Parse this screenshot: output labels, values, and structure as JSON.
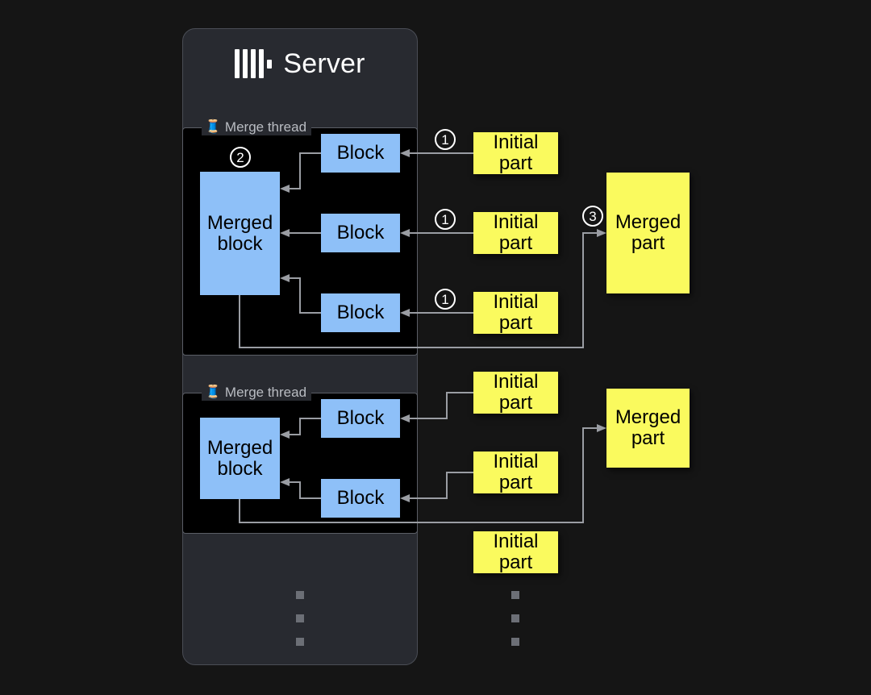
{
  "page": {
    "background": "#151515",
    "title": "ClickHouse merge thread diagram"
  },
  "server": {
    "title": "Server",
    "logo_icon": "clickhouse-logo",
    "card_color": "#282a30",
    "border_color": "#4a4d55"
  },
  "threads": [
    {
      "id": "thread-1",
      "label": "Merge thread",
      "icon": "thread-spool-icon",
      "merged_block": {
        "label": "Merged\nblock",
        "line1": "Merged",
        "line2": "block",
        "color": "#8ec0f8"
      },
      "blocks": [
        {
          "label": "Block",
          "color": "#8ec0f8"
        },
        {
          "label": "Block",
          "color": "#8ec0f8"
        },
        {
          "label": "Block",
          "color": "#8ec0f8"
        }
      ]
    },
    {
      "id": "thread-2",
      "label": "Merge thread",
      "icon": "thread-spool-icon",
      "merged_block": {
        "label": "Merged\nblock",
        "line1": "Merged",
        "line2": "block",
        "color": "#8ec0f8"
      },
      "blocks": [
        {
          "label": "Block",
          "color": "#8ec0f8"
        },
        {
          "label": "Block",
          "color": "#8ec0f8"
        }
      ]
    }
  ],
  "initial_parts": [
    {
      "line1": "Initial",
      "line2": "part",
      "color": "#fafa5e"
    },
    {
      "line1": "Initial",
      "line2": "part",
      "color": "#fafa5e"
    },
    {
      "line1": "Initial",
      "line2": "part",
      "color": "#fafa5e"
    },
    {
      "line1": "Initial",
      "line2": "part",
      "color": "#fafa5e"
    },
    {
      "line1": "Initial",
      "line2": "part",
      "color": "#fafa5e"
    },
    {
      "line1": "Initial",
      "line2": "part",
      "color": "#fafa5e"
    }
  ],
  "merged_parts": [
    {
      "line1": "Merged",
      "line2": "part",
      "color": "#fafa5e"
    },
    {
      "line1": "Merged",
      "line2": "part",
      "color": "#fafa5e"
    }
  ],
  "steps": [
    {
      "id": "step-1a",
      "label": "①",
      "number": "1"
    },
    {
      "id": "step-1b",
      "label": "①",
      "number": "1"
    },
    {
      "id": "step-1c",
      "label": "①",
      "number": "1"
    },
    {
      "id": "step-2",
      "label": "②",
      "number": "2"
    },
    {
      "id": "step-3",
      "label": "③",
      "number": "3"
    }
  ],
  "ellipsis": {
    "glyph": "▪",
    "count": 3,
    "color": "#6c6f76"
  },
  "colors": {
    "block_blue": "#8ec0f8",
    "part_yellow": "#fafa5e",
    "wire": "#9a9da3",
    "thread_bg": "#000000",
    "page_bg": "#151515"
  }
}
